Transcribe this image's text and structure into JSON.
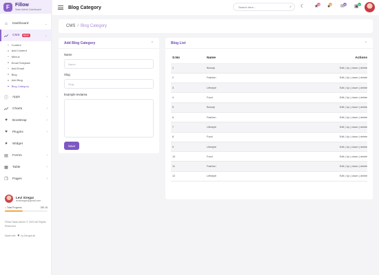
{
  "brand": {
    "logo_letter": "F",
    "name": "Fillow",
    "subtitle": "Saas Admin Dashboard"
  },
  "sidebar": {
    "items": [
      {
        "label": "Dashboard",
        "icon": "home-icon"
      },
      {
        "label": "CMS",
        "badge": "NEW",
        "icon": "chart-icon"
      },
      {
        "label": "Apps",
        "icon": "info-icon"
      },
      {
        "label": "Charts",
        "icon": "line-chart-icon"
      },
      {
        "label": "Bootstrap",
        "icon": "heart-icon"
      },
      {
        "label": "Plugins",
        "icon": "heart-icon"
      },
      {
        "label": "Widget",
        "icon": "user-icon"
      },
      {
        "label": "Forms",
        "icon": "file-icon"
      },
      {
        "label": "Table",
        "icon": "table-icon"
      },
      {
        "label": "Pages",
        "icon": "pages-icon"
      }
    ],
    "cms_submenu": [
      "Content",
      "Add Content",
      "Menus",
      "Email Template",
      "Add Email",
      "Blog",
      "Add Blog",
      "Blog Category"
    ]
  },
  "profile": {
    "name": "Levi Siregar",
    "email": "levisiregar@gmail.com",
    "progress_label": "Total Progress",
    "progress_value": "250.16",
    "progress_fraction": 0.42
  },
  "footer": {
    "copyright": "Fillow Saas Admin © 2023 All Rights Reserved",
    "made_with": "Made with",
    "by": "by DexignLab"
  },
  "header": {
    "title": "Blog Category",
    "search_placeholder": "Search here...",
    "notifications": [
      {
        "icon": "star-icon",
        "count": "76",
        "color": "#f06ba4"
      },
      {
        "icon": "bell-icon",
        "count": "12",
        "color": "#f3a843"
      },
      {
        "icon": "mail-icon",
        "count": "76",
        "color": "#9b6bd6"
      },
      {
        "icon": "cart-icon",
        "count": "12",
        "color": "#2ebd6f"
      }
    ]
  },
  "breadcrumb": {
    "root": "CMS",
    "separator": "/",
    "current": "Blog Category"
  },
  "form_card": {
    "title": "Add Blog Category",
    "name_label": "Name",
    "name_placeholder": "Name",
    "slug_label": "Slug",
    "slug_placeholder": "Slug",
    "textarea_label": "Example textarea",
    "save_label": "Save"
  },
  "list_card": {
    "title": "Blog List",
    "columns": [
      "S.No",
      "Name",
      "Actions"
    ],
    "rows": [
      {
        "sno": "1",
        "name": "Beauty",
        "actions": "Edit | Up | down | delete"
      },
      {
        "sno": "2",
        "name": "Fashion",
        "actions": "Edit | Up | down | delete"
      },
      {
        "sno": "3",
        "name": "Lifestyle",
        "actions": "Edit | Up | down | delete"
      },
      {
        "sno": "4",
        "name": "Food",
        "actions": "Edit | Up | down | delete"
      },
      {
        "sno": "5",
        "name": "Beauty",
        "actions": "Edit | Up | down | delete"
      },
      {
        "sno": "6",
        "name": "Fashion",
        "actions": "Edit | Up | down | delete"
      },
      {
        "sno": "7",
        "name": "Lifestyle",
        "actions": "Edit | Up | down | delete"
      },
      {
        "sno": "8",
        "name": "Food",
        "actions": "Edit | Up | down | delete"
      },
      {
        "sno": "9",
        "name": "Lifestyle",
        "actions": "Edit | Up | down | delete"
      },
      {
        "sno": "10",
        "name": "Food",
        "actions": "Edit | Up | down | delete"
      },
      {
        "sno": "11",
        "name": "Fashion",
        "actions": "Edit | Up | down | delete"
      },
      {
        "sno": "12",
        "name": "Lifestyle",
        "actions": "Edit | Up | down | delete"
      }
    ]
  },
  "colors": {
    "accent": "#7e58c2",
    "brand_bg": "#f1ebfb",
    "crumb_current": "#a989d9"
  }
}
